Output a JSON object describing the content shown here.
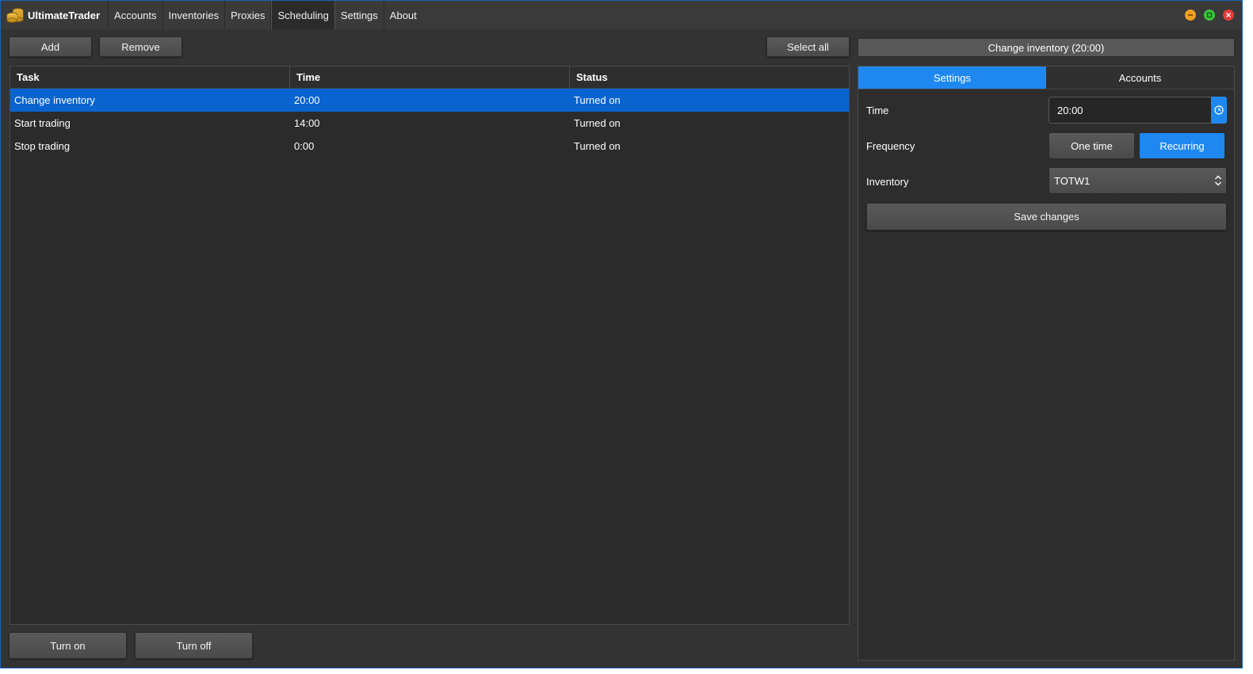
{
  "app": {
    "title": "UltimateTrader"
  },
  "menu": [
    {
      "label": "Accounts"
    },
    {
      "label": "Inventories"
    },
    {
      "label": "Proxies"
    },
    {
      "label": "Scheduling",
      "active": true
    },
    {
      "label": "Settings"
    },
    {
      "label": "About"
    }
  ],
  "toolbar": {
    "add": "Add",
    "remove": "Remove",
    "select_all": "Select all"
  },
  "grid": {
    "columns": [
      "Task",
      "Time",
      "Status"
    ],
    "rows": [
      {
        "task": "Change inventory",
        "time": "20:00",
        "status": "Turned on",
        "selected": true
      },
      {
        "task": "Start trading",
        "time": "14:00",
        "status": "Turned on"
      },
      {
        "task": "Stop trading",
        "time": "0:00",
        "status": "Turned on"
      }
    ]
  },
  "footer": {
    "turn_on": "Turn on",
    "turn_off": "Turn off"
  },
  "panel": {
    "header": "Change inventory (20:00)",
    "tabs": [
      {
        "label": "Settings",
        "active": true
      },
      {
        "label": "Accounts"
      }
    ],
    "time_label": "Time",
    "time_value": "20:00",
    "frequency_label": "Frequency",
    "frequency_options": [
      "One time",
      "Recurring"
    ],
    "frequency_selected": "Recurring",
    "inventory_label": "Inventory",
    "inventory_value": "TOTW1",
    "save": "Save changes"
  },
  "colors": {
    "accent": "#1e88f0",
    "selection": "#0a64d0",
    "background": "#333333"
  }
}
